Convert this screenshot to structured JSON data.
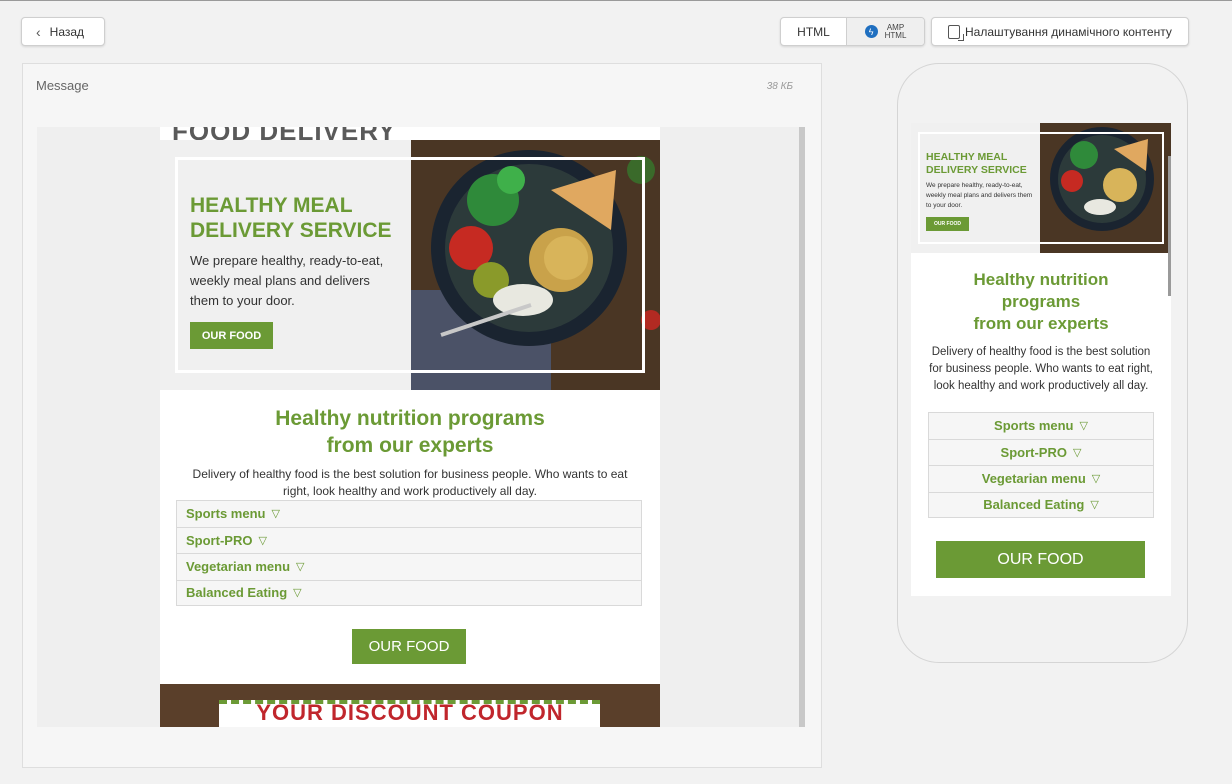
{
  "toolbar": {
    "back_label": "Назад",
    "html_label": "HTML",
    "amp_label_line1": "AMP",
    "amp_label_line2": "HTML",
    "dynamic_content_label": "Налаштування динамічного контенту"
  },
  "panel": {
    "title": "Message",
    "size": "38 КБ"
  },
  "email": {
    "cut_title": "FOOD DELIVERY",
    "hero_heading_line1": "HEALTHY MEAL",
    "hero_heading_line2": "DELIVERY SERVICE",
    "hero_text": "We prepare healthy, ready-to-eat, weekly meal plans and delivers them to your door.",
    "hero_button": "OUR FOOD",
    "section_heading_line1": "Healthy nutrition programs",
    "section_heading_line2": "from our experts",
    "section_text": "Delivery of healthy food is the best solution for business people. Who wants to eat right, look healthy and work productively all day.",
    "menu_items": [
      "Sports menu",
      "Sport-PRO",
      "Vegetarian menu",
      "Balanced Eating"
    ],
    "menu_arrow": "▽",
    "cta_button": "OUR FOOD",
    "coupon_text": "YOUR DISCOUNT COUPON"
  },
  "mobile": {
    "section_heading_line1": "Healthy nutrition",
    "section_heading_line2": "programs",
    "section_heading_line3": "from our experts"
  },
  "colors": {
    "brand_green": "#6b9a35",
    "coupon_red": "#c0262c",
    "amp_blue": "#1f6fc0"
  },
  "icons": {
    "back": "chevron-left-icon",
    "amp": "lightning-icon",
    "dynamic": "dynamic-content-icon",
    "menu_toggle": "triangle-down-icon"
  }
}
